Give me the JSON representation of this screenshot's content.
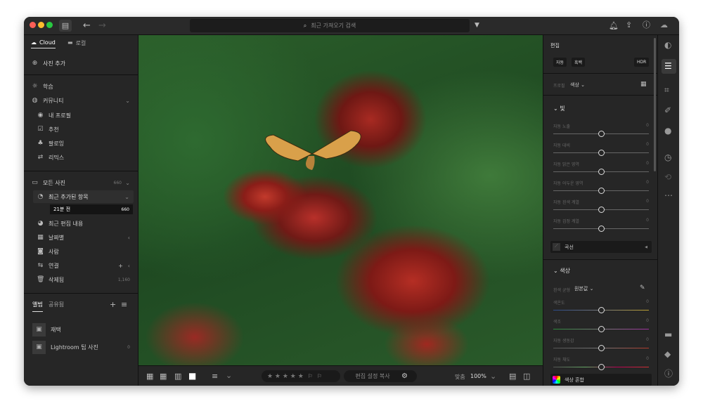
{
  "titlebar": {
    "search_placeholder": "최근 가져오기 검색"
  },
  "left": {
    "tabs": [
      {
        "label": "Cloud"
      },
      {
        "label": "로컬"
      }
    ],
    "add_photos": "사진 추가",
    "learn": "학습",
    "community": "커뮤니티",
    "community_items": [
      {
        "label": "내 프로필",
        "icon": "profile-icon"
      },
      {
        "label": "추천",
        "icon": "badge-icon"
      },
      {
        "label": "팔로잉",
        "icon": "people-icon"
      },
      {
        "label": "리믹스",
        "icon": "remix-icon"
      }
    ],
    "all_photos": {
      "label": "모든 사진",
      "count": "660"
    },
    "recent_added": "최근 추가된 항목",
    "recent_sub": {
      "label": "21분 전",
      "count": "660"
    },
    "items": [
      {
        "label": "최근 편집 내용"
      },
      {
        "label": "날짜별"
      },
      {
        "label": "사람"
      },
      {
        "label": "연결"
      },
      {
        "label": "삭제됨",
        "count": "1,160"
      }
    ],
    "album_tabs": [
      {
        "label": "앨범"
      },
      {
        "label": "공유됨"
      }
    ],
    "albums": [
      {
        "label": "재택",
        "count": ""
      },
      {
        "label": "Lightroom 팁 사진",
        "count": "0"
      }
    ]
  },
  "bottom": {
    "stars": "★ ★ ★ ★ ★",
    "copy_settings": "편집 설정 복사",
    "fit_label": "맞춤",
    "zoom": "100%"
  },
  "right": {
    "title": "편집",
    "auto": "자동",
    "bw": "흑백",
    "hdr": "HDR",
    "profile_label": "프로필",
    "profile_value": "색상",
    "light": {
      "title": "빛",
      "sliders": [
        {
          "label": "자동 노출",
          "value": "0",
          "position": 0.5
        },
        {
          "label": "자동 대비",
          "value": "0",
          "position": 0.5
        },
        {
          "label": "자동 밝은 영역",
          "value": "0",
          "position": 0.5
        },
        {
          "label": "자동 어두운 영역",
          "value": "0",
          "position": 0.5
        },
        {
          "label": "자동 흰색 계열",
          "value": "0",
          "position": 0.5
        },
        {
          "label": "자동 검정 계열",
          "value": "0",
          "position": 0.5
        }
      ]
    },
    "curve": "곡선",
    "color": {
      "title": "색상",
      "wb_label": "흰색 균형",
      "wb_value": "원본값",
      "sliders": [
        {
          "label": "색온도",
          "value": "0",
          "position": 0.5
        },
        {
          "label": "색조",
          "value": "0",
          "position": 0.5
        },
        {
          "label": "자동 생동감",
          "value": "0",
          "position": 0.5
        },
        {
          "label": "자동 채도",
          "value": "0",
          "position": 0.5
        }
      ]
    },
    "color_mix": "색상 혼합"
  },
  "colors": {
    "accent": "#ffffff",
    "panel": "#262626"
  }
}
